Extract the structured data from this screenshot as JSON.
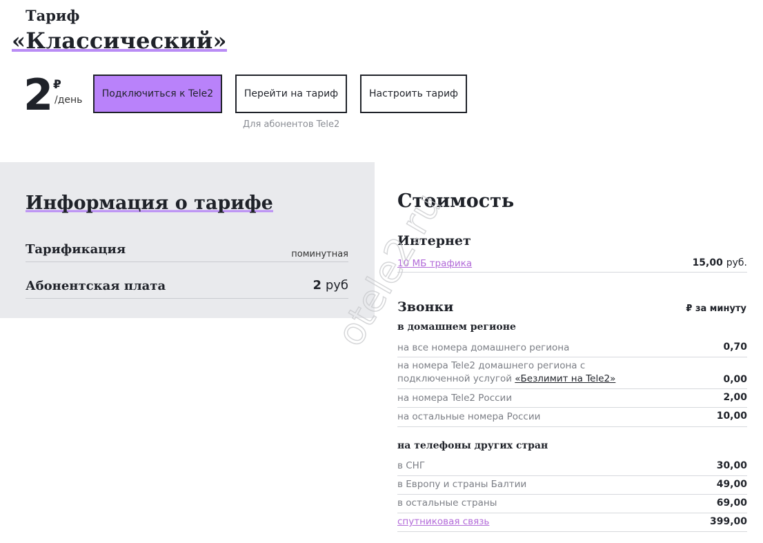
{
  "header": {
    "tariff_prefix": "Тариф",
    "tariff_name": "«Классический»"
  },
  "price": {
    "amount": "2",
    "currency": "₽",
    "unit": "/день"
  },
  "buttons": {
    "connect": "Подключиться к Tele2",
    "switch": "Перейти на тариф",
    "configure": "Настроить тариф",
    "switch_note": "Для абонентов Tele2"
  },
  "info": {
    "title": "Информация о тарифе",
    "rows": [
      {
        "label": "Тарификация",
        "value": "поминутная"
      },
      {
        "label": "Абонентская плата",
        "value_num": "2",
        "value_unit": "руб"
      }
    ]
  },
  "cost": {
    "title": "Стоимость",
    "internet": {
      "title": "Интернет",
      "rows": [
        {
          "label": "10 МБ трафика",
          "value": "15,00",
          "unit": "руб."
        }
      ]
    },
    "calls": {
      "title": "Звонки",
      "per_minute": "₽ за минуту",
      "home_region_title": "в домашнем регионе",
      "home_rows": [
        {
          "label": "на все номера домашнего региона",
          "value": "0,70"
        },
        {
          "label_line1": "на номера Tele2 домашнего региона с",
          "label_line2": "подключенной услугой ",
          "label_link": "«Безлимит на Tele2»",
          "value": "0,00"
        },
        {
          "label": "на номера Tele2 России",
          "value": "2,00"
        },
        {
          "label": "на остальные номера России",
          "value": "10,00"
        }
      ],
      "foreign_title": "на телефоны других стран",
      "foreign_rows": [
        {
          "label": "в СНГ",
          "value": "30,00"
        },
        {
          "label": "в Европу и страны Балтии",
          "value": "49,00"
        },
        {
          "label": "в остальные страны",
          "value": "69,00"
        },
        {
          "label": "спутниковая связь",
          "value": "399,00"
        }
      ]
    }
  },
  "watermark": {
    "text": "otele2.ru"
  },
  "colors": {
    "accent": "#b982fa",
    "link": "#b26ad8",
    "panel": "#e9eaed",
    "text": "#1f2229"
  }
}
